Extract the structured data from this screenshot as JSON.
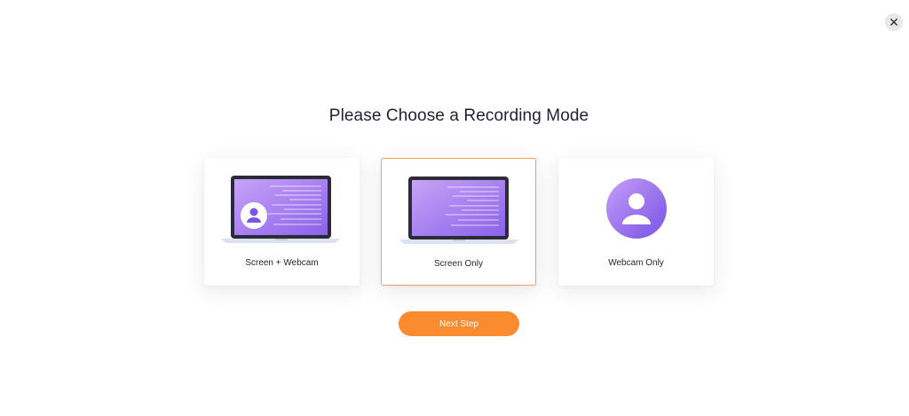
{
  "dialog": {
    "close_icon": "close-icon",
    "close_glyph": "✕",
    "title": "Please Choose a Recording Mode"
  },
  "modes": [
    {
      "label": "Screen + Webcam",
      "icon": "laptop-webcam-icon",
      "selected": false
    },
    {
      "label": "Screen Only",
      "icon": "laptop-icon",
      "selected": true
    },
    {
      "label": "Webcam Only",
      "icon": "user-avatar-icon",
      "selected": false
    }
  ],
  "actions": {
    "next_label": "Next Step"
  },
  "colors": {
    "accent_orange": "#fb8b2f",
    "selected_border": "#f5a25d",
    "purple_gradient_start": "#c49bf6",
    "purple_gradient_end": "#7b57e6",
    "laptop_frame": "#2c2c38"
  }
}
